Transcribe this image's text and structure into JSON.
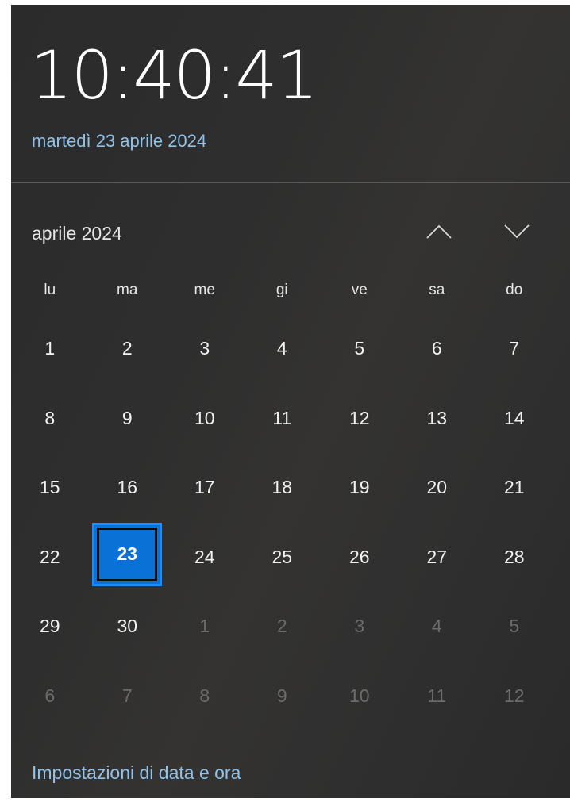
{
  "clock": {
    "time": "10:40:41",
    "date": "martedì 23 aprile 2024"
  },
  "calendar": {
    "month_label": "aprile 2024",
    "nav": {
      "up_icon": "chevron-up-icon",
      "down_icon": "chevron-down-icon"
    },
    "weekdays": [
      "lu",
      "ma",
      "me",
      "gi",
      "ve",
      "sa",
      "do"
    ],
    "weeks": [
      [
        {
          "label": "1",
          "current": true
        },
        {
          "label": "2",
          "current": true
        },
        {
          "label": "3",
          "current": true
        },
        {
          "label": "4",
          "current": true
        },
        {
          "label": "5",
          "current": true
        },
        {
          "label": "6",
          "current": true
        },
        {
          "label": "7",
          "current": true
        }
      ],
      [
        {
          "label": "8",
          "current": true
        },
        {
          "label": "9",
          "current": true
        },
        {
          "label": "10",
          "current": true
        },
        {
          "label": "11",
          "current": true
        },
        {
          "label": "12",
          "current": true
        },
        {
          "label": "13",
          "current": true
        },
        {
          "label": "14",
          "current": true
        }
      ],
      [
        {
          "label": "15",
          "current": true
        },
        {
          "label": "16",
          "current": true
        },
        {
          "label": "17",
          "current": true
        },
        {
          "label": "18",
          "current": true
        },
        {
          "label": "19",
          "current": true
        },
        {
          "label": "20",
          "current": true
        },
        {
          "label": "21",
          "current": true
        }
      ],
      [
        {
          "label": "22",
          "current": true
        },
        {
          "label": "23",
          "current": true,
          "today": true
        },
        {
          "label": "24",
          "current": true
        },
        {
          "label": "25",
          "current": true
        },
        {
          "label": "26",
          "current": true
        },
        {
          "label": "27",
          "current": true
        },
        {
          "label": "28",
          "current": true
        }
      ],
      [
        {
          "label": "29",
          "current": true
        },
        {
          "label": "30",
          "current": true
        },
        {
          "label": "1",
          "current": false
        },
        {
          "label": "2",
          "current": false
        },
        {
          "label": "3",
          "current": false
        },
        {
          "label": "4",
          "current": false
        },
        {
          "label": "5",
          "current": false
        }
      ],
      [
        {
          "label": "6",
          "current": false
        },
        {
          "label": "7",
          "current": false
        },
        {
          "label": "8",
          "current": false
        },
        {
          "label": "9",
          "current": false
        },
        {
          "label": "10",
          "current": false
        },
        {
          "label": "11",
          "current": false
        },
        {
          "label": "12",
          "current": false
        }
      ]
    ]
  },
  "footer": {
    "settings_link": "Impostazioni di data e ora"
  },
  "colors": {
    "accent": "#0a72d6",
    "link": "#8fc1ea",
    "background": "#2e2e2e",
    "muted_day": "#6b6b6b"
  }
}
